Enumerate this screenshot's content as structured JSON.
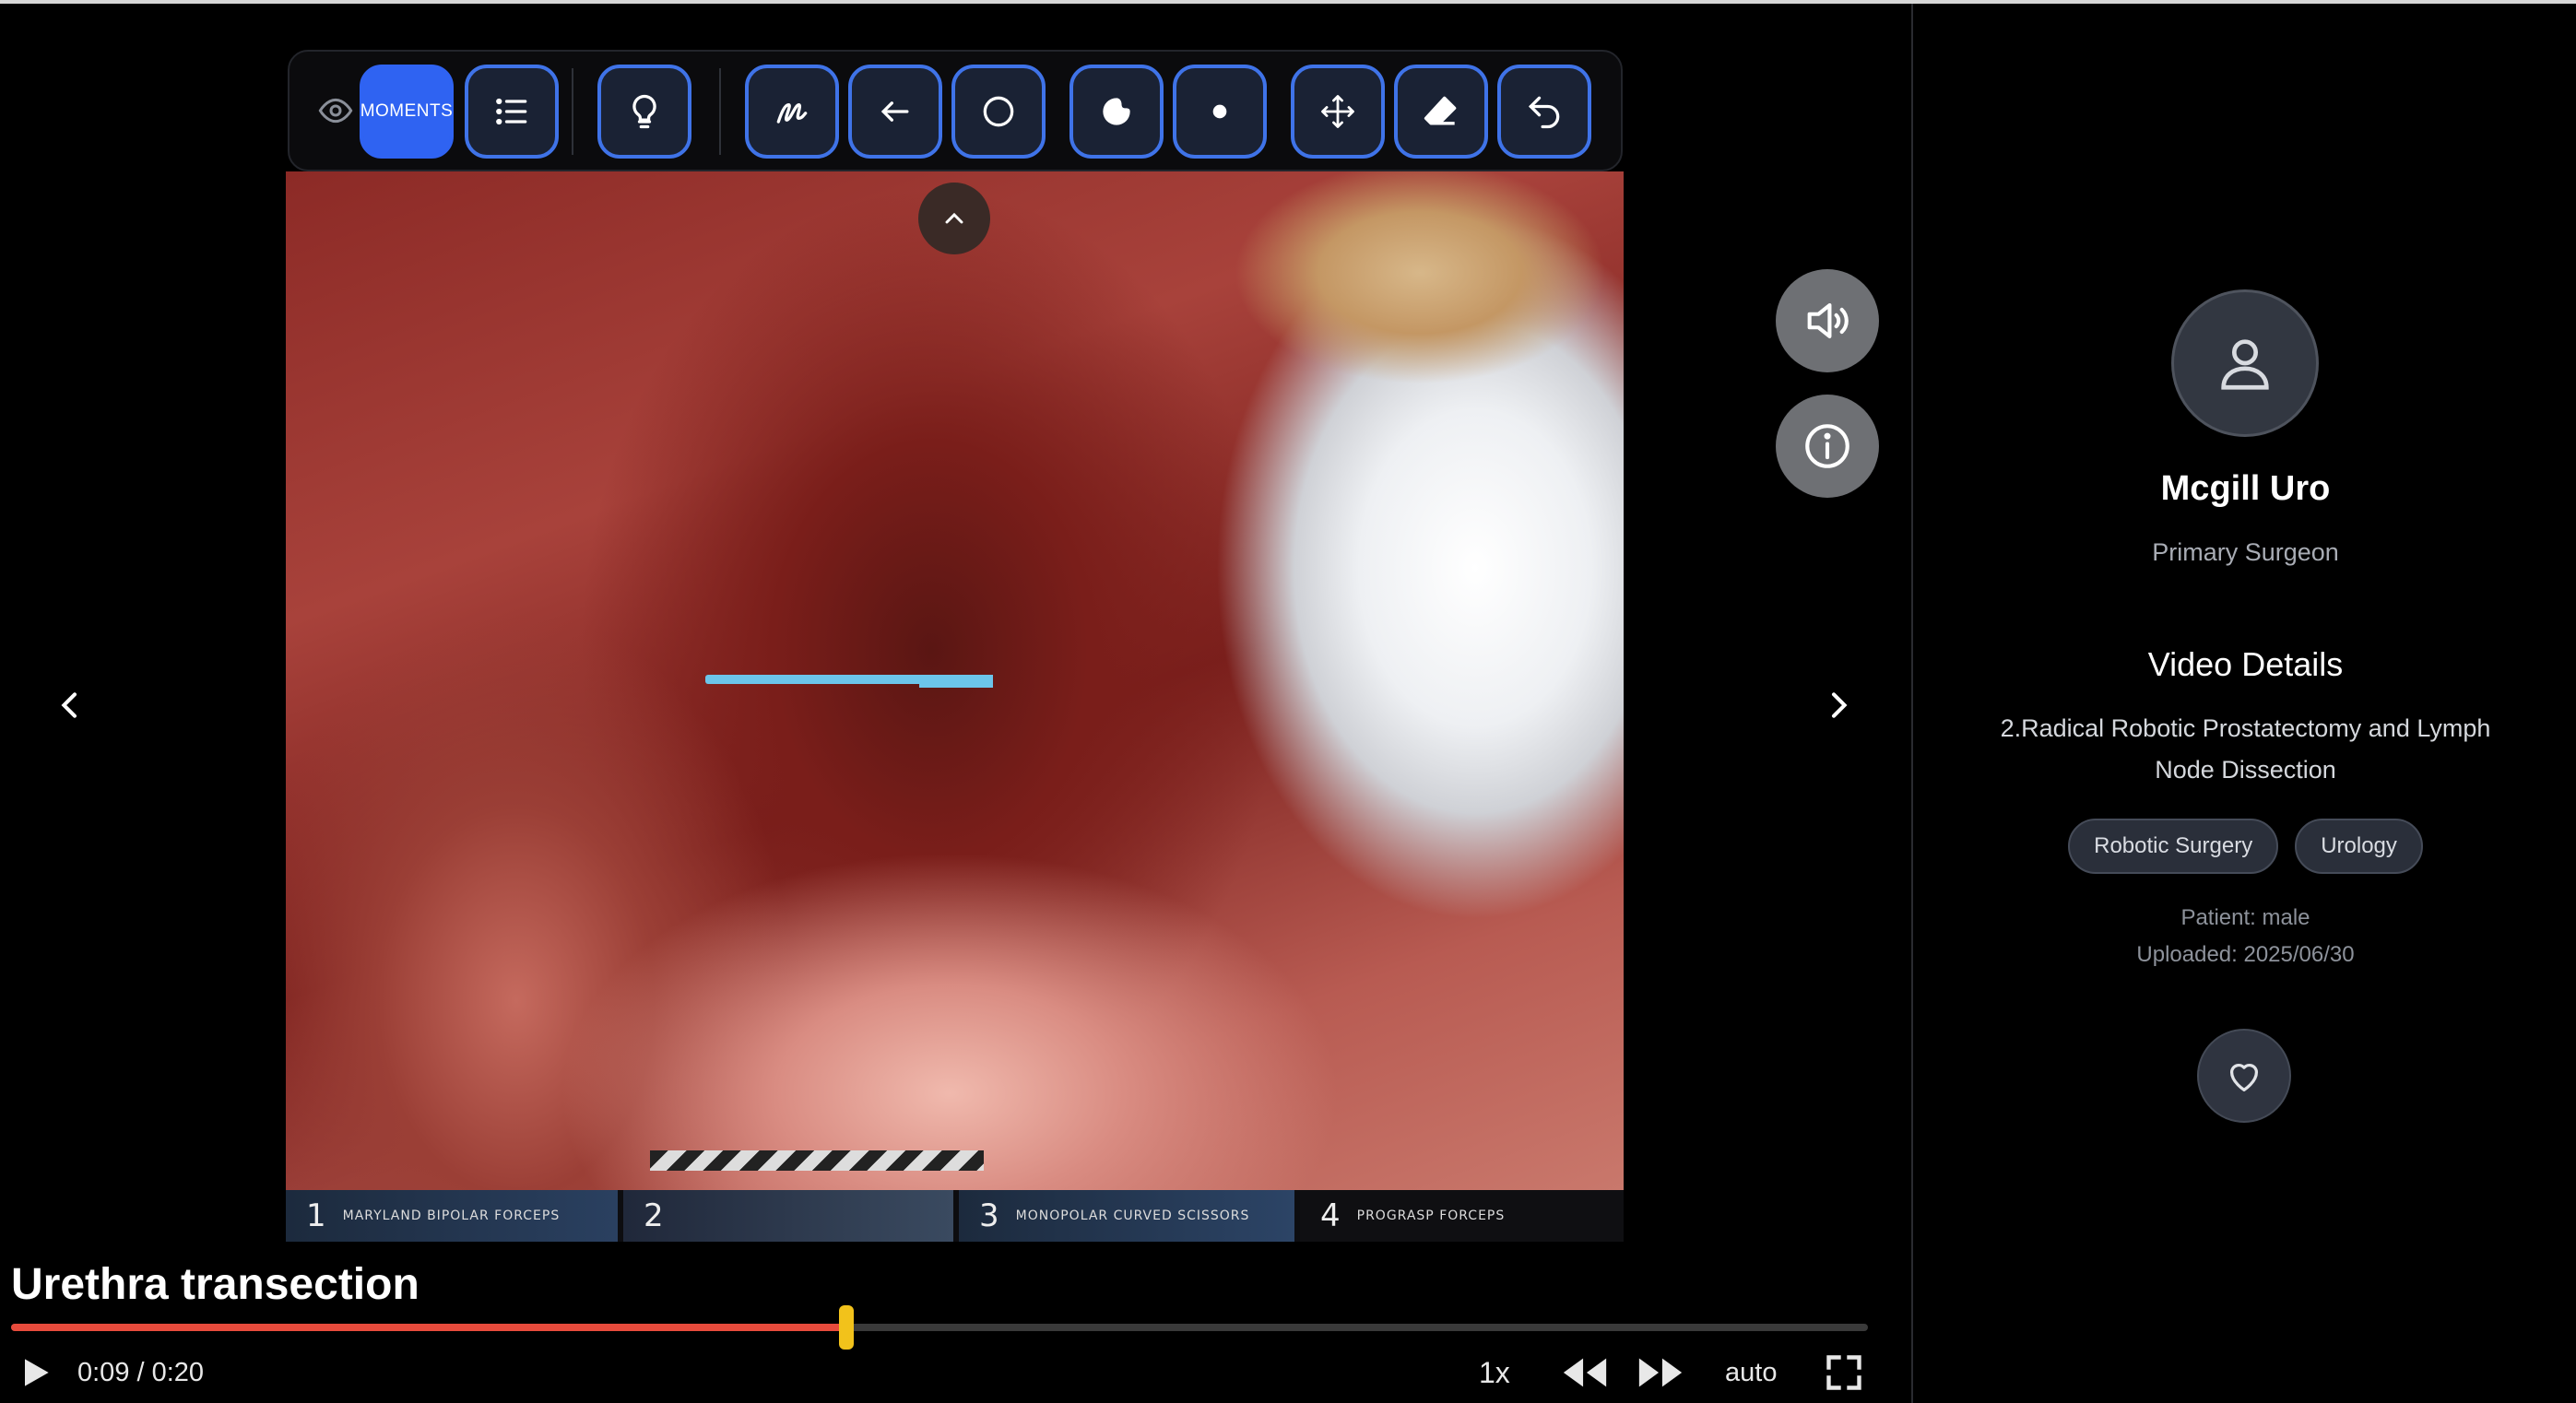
{
  "toolbar": {
    "moments_label": "MOMENTS",
    "buttons": [
      "eye-icon",
      "moments",
      "list-icon",
      "lightbulb-icon",
      "pen-icon",
      "arrow-left-icon",
      "circle-icon",
      "fill-shape-icon",
      "dot-icon",
      "move-icon",
      "eraser-icon",
      "undo-icon"
    ]
  },
  "video": {
    "hud": [
      {
        "num": "1",
        "text": "MARYLAND BIPOLAR FORCEPS"
      },
      {
        "num": "2",
        "text": ""
      },
      {
        "num": "3",
        "text": "MONOPOLAR CURVED SCISSORS"
      },
      {
        "num": "4",
        "text": "PROGRASP FORCEPS"
      }
    ]
  },
  "player": {
    "clip_title": "Urethra transection",
    "time": "0:09 / 0:20",
    "progress": 0.45,
    "speed": "1x",
    "quality": "auto"
  },
  "panel": {
    "surgeon_name": "Mcgill Uro",
    "surgeon_role": "Primary Surgeon",
    "details_title": "Video Details",
    "details_text": "2.Radical Robotic Prostatectomy and Lymph Node Dissection",
    "tags": [
      "Robotic Surgery",
      "Urology"
    ],
    "patient": "Patient: male",
    "uploaded": "Uploaded: 2025/06/30"
  },
  "colors": {
    "accent": "#2f63f2",
    "progress": "#e74b3c",
    "handle": "#f2c21b"
  }
}
